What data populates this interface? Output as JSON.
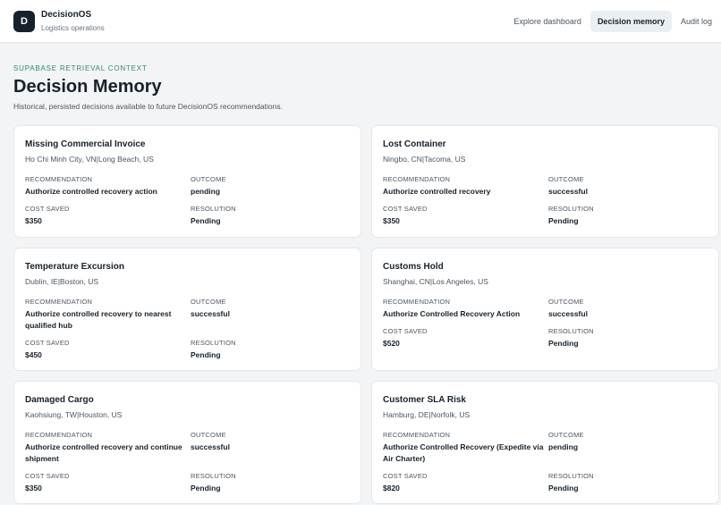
{
  "app": {
    "logo_letter": "D",
    "name": "DecisionOS",
    "subtitle": "Logistics operations"
  },
  "nav": {
    "items": [
      {
        "label": "Explore dashboard",
        "active": false
      },
      {
        "label": "Decision memory",
        "active": true
      },
      {
        "label": "Audit log",
        "active": false
      }
    ]
  },
  "header": {
    "eyebrow": "SUPABASE RETRIEVAL CONTEXT",
    "title": "Decision Memory",
    "description": "Historical, persisted decisions available to future DecisionOS recommendations."
  },
  "labels": {
    "recommendation": "RECOMMENDATION",
    "outcome": "OUTCOME",
    "cost_saved": "COST SAVED",
    "resolution": "RESOLUTION"
  },
  "cards": [
    {
      "title": "Missing Commercial Invoice",
      "route": "Ho Chi Minh City, VN|Long Beach, US",
      "recommendation": "Authorize controlled recovery action",
      "outcome": "pending",
      "cost_saved": "$350",
      "resolution": "Pending"
    },
    {
      "title": "Lost Container",
      "route": "Ningbo, CN|Tacoma, US",
      "recommendation": "Authorize controlled recovery",
      "outcome": "successful",
      "cost_saved": "$350",
      "resolution": "Pending"
    },
    {
      "title": "Temperature Excursion",
      "route": "Dublin, IE|Boston, US",
      "recommendation": "Authorize controlled recovery to nearest qualified hub",
      "outcome": "successful",
      "cost_saved": "$450",
      "resolution": "Pending"
    },
    {
      "title": "Customs Hold",
      "route": "Shanghai, CN|Los Angeles, US",
      "recommendation": "Authorize Controlled Recovery Action",
      "outcome": "successful",
      "cost_saved": "$520",
      "resolution": "Pending"
    },
    {
      "title": "Damaged Cargo",
      "route": "Kaohsiung, TW|Houston, US",
      "recommendation": "Authorize controlled recovery and continue shipment",
      "outcome": "successful",
      "cost_saved": "$350",
      "resolution": "Pending"
    },
    {
      "title": "Customer SLA Risk",
      "route": "Hamburg, DE|Norfolk, US",
      "recommendation": "Authorize Controlled Recovery (Expedite via Air Charter)",
      "outcome": "pending",
      "cost_saved": "$820",
      "resolution": "Pending"
    }
  ]
}
